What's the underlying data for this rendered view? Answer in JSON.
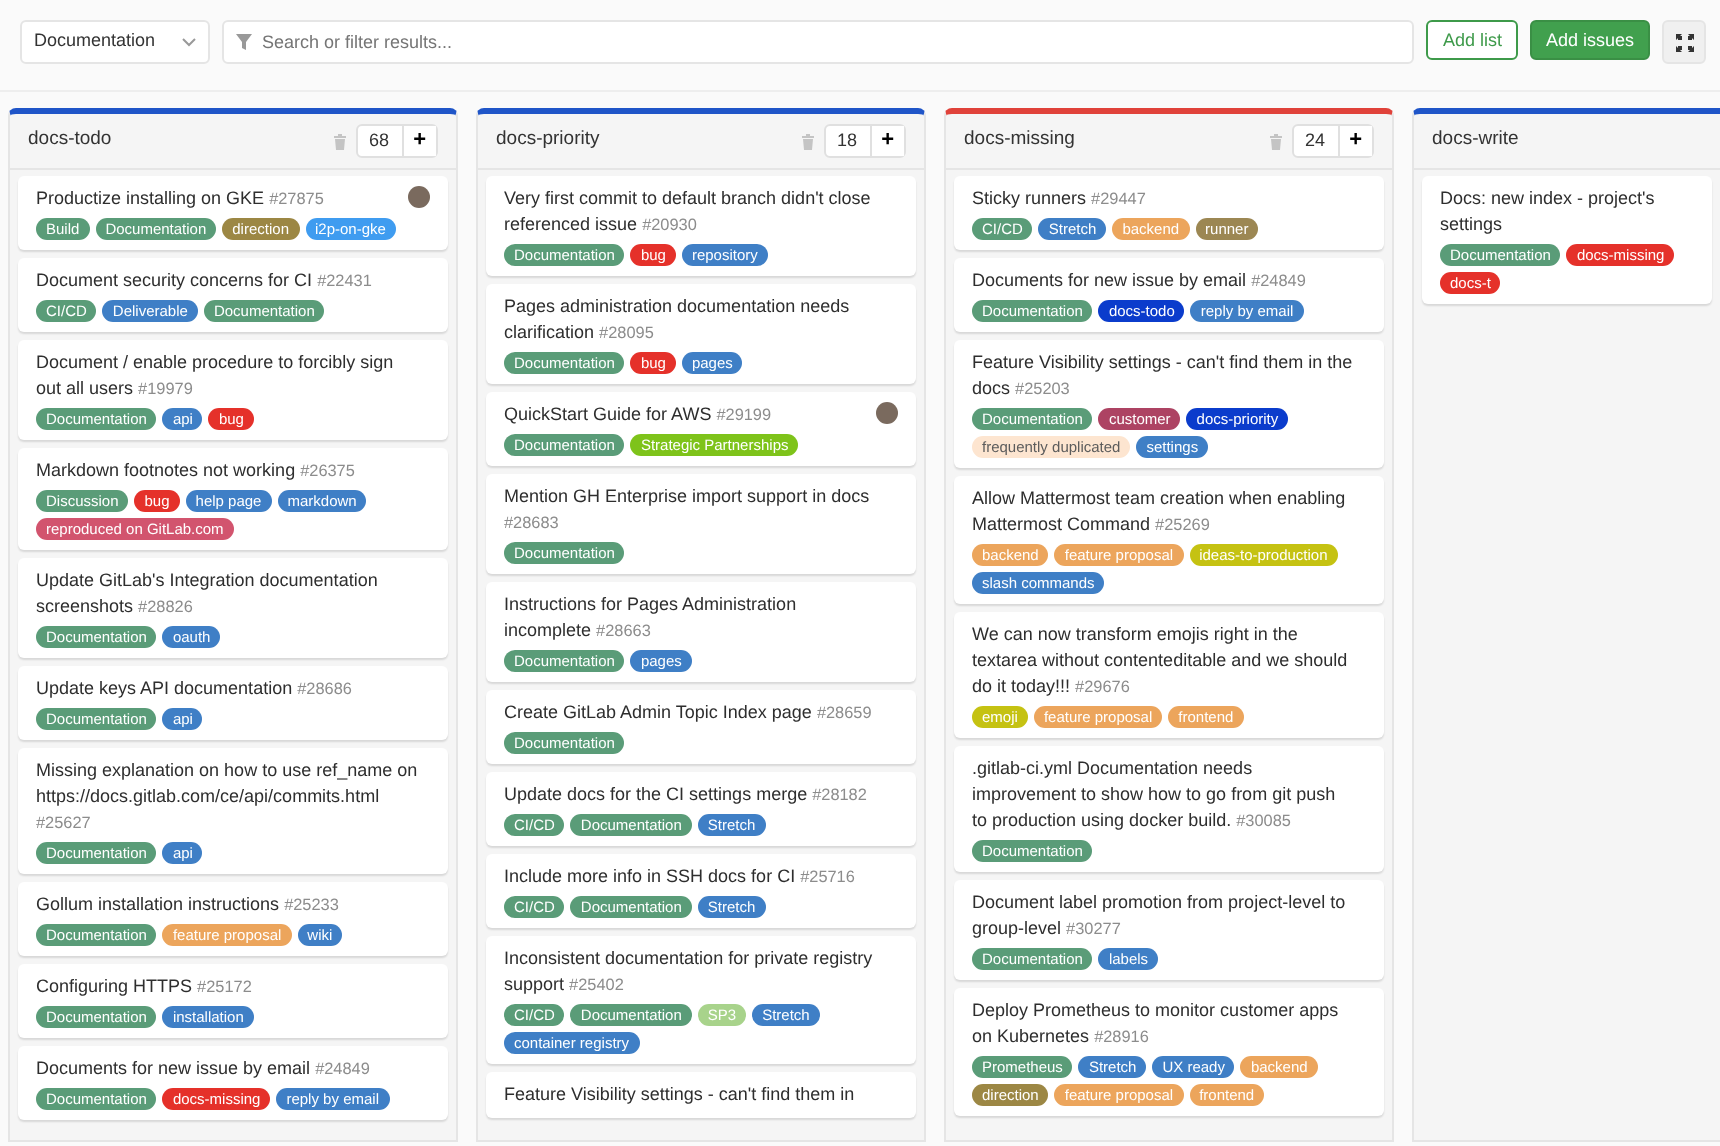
{
  "filter_bar": {
    "board_dropdown": "Documentation",
    "search": {
      "placeholder": "Search or filter results..."
    },
    "buttons": [
      {
        "kind": "outline",
        "label": "Add list"
      },
      {
        "kind": "primary",
        "label": "Add issues"
      },
      {
        "kind": "icon"
      }
    ]
  },
  "lists": [
    {
      "title": "docs-todo",
      "color": "#1f55c8",
      "count": "68",
      "add": "+",
      "cards": [
        {
          "title": "Productize installing on GKE",
          "ref": "#27875",
          "assigned": true,
          "labels": [
            {
              "text": "Build",
              "color": "#5a9c78"
            },
            {
              "text": "Documentation",
              "color": "#5a9c78"
            },
            {
              "text": "direction",
              "color": "#9c8744"
            },
            {
              "text": "i2p-on-gke",
              "color": "#3f9cf0"
            }
          ]
        },
        {
          "title": "Document security concerns for CI",
          "ref": "#22431",
          "assigned": false,
          "labels": [
            {
              "text": "CI/CD",
              "color": "#5a9c78"
            },
            {
              "text": "Deliverable",
              "color": "#3f7fc6"
            },
            {
              "text": "Documentation",
              "color": "#5a9c78"
            }
          ]
        },
        {
          "title": "Document / enable procedure to forcibly sign out all users",
          "ref": "#19979",
          "assigned": false,
          "labels": [
            {
              "text": "Documentation",
              "color": "#5a9c78"
            },
            {
              "text": "api",
              "color": "#3f7fc6"
            },
            {
              "text": "bug",
              "color": "#e5312a"
            }
          ]
        },
        {
          "title": "Markdown footnotes not working",
          "ref": "#26375",
          "assigned": false,
          "labels": [
            {
              "text": "Discussion",
              "color": "#5a9c78"
            },
            {
              "text": "bug",
              "color": "#e5312a"
            },
            {
              "text": "help page",
              "color": "#3f7fc6"
            },
            {
              "text": "markdown",
              "color": "#3f7fc6"
            },
            {
              "text": "reproduced on GitLab.com",
              "color": "#d2546e"
            }
          ]
        },
        {
          "title": "Update GitLab's Integration documentation screenshots",
          "ref": "#28826",
          "assigned": false,
          "labels": [
            {
              "text": "Documentation",
              "color": "#5a9c78"
            },
            {
              "text": "oauth",
              "color": "#3f7fc6"
            }
          ]
        },
        {
          "title": "Update keys API documentation",
          "ref": "#28686",
          "assigned": false,
          "labels": [
            {
              "text": "Documentation",
              "color": "#5a9c78"
            },
            {
              "text": "api",
              "color": "#3f7fc6"
            }
          ]
        },
        {
          "title": "Missing explanation on how to use ref_name on https://docs.gitlab.com/ce/api/commits.html",
          "ref": "#25627",
          "assigned": false,
          "labels": [
            {
              "text": "Documentation",
              "color": "#5a9c78"
            },
            {
              "text": "api",
              "color": "#3f7fc6"
            }
          ]
        },
        {
          "title": "Gollum installation instructions",
          "ref": "#25233",
          "assigned": false,
          "labels": [
            {
              "text": "Documentation",
              "color": "#5a9c78"
            },
            {
              "text": "feature proposal",
              "color": "#eca55c"
            },
            {
              "text": "wiki",
              "color": "#3f7fc6"
            }
          ]
        },
        {
          "title": "Configuring HTTPS",
          "ref": "#25172",
          "assigned": false,
          "labels": [
            {
              "text": "Documentation",
              "color": "#5a9c78"
            },
            {
              "text": "installation",
              "color": "#3f7fc6"
            }
          ]
        },
        {
          "title": "Documents for new issue by email",
          "ref": "#24849",
          "assigned": false,
          "labels": [
            {
              "text": "Documentation",
              "color": "#5a9c78"
            },
            {
              "text": "docs-missing",
              "color": "#e5312a"
            },
            {
              "text": "reply by email",
              "color": "#3f7fc6"
            }
          ]
        }
      ]
    },
    {
      "title": "docs-priority",
      "color": "#1f55c8",
      "count": "18",
      "add": "+",
      "cards": [
        {
          "title": "Very first commit to default branch didn't close referenced issue",
          "ref": "#20930",
          "assigned": false,
          "labels": [
            {
              "text": "Documentation",
              "color": "#5a9c78"
            },
            {
              "text": "bug",
              "color": "#e5312a"
            },
            {
              "text": "repository",
              "color": "#3f7fc6"
            }
          ]
        },
        {
          "title": "Pages administration documentation needs clarification",
          "ref": "#28095",
          "assigned": false,
          "labels": [
            {
              "text": "Documentation",
              "color": "#5a9c78"
            },
            {
              "text": "bug",
              "color": "#e5312a"
            },
            {
              "text": "pages",
              "color": "#3f7fc6"
            }
          ]
        },
        {
          "title": "QuickStart Guide for AWS",
          "ref": "#29199",
          "assigned": true,
          "labels": [
            {
              "text": "Documentation",
              "color": "#5a9c78"
            },
            {
              "text": "Strategic Partnerships",
              "color": "#7ec31a"
            }
          ]
        },
        {
          "title": "Mention GH Enterprise import support in docs",
          "ref": "#28683",
          "assigned": false,
          "labels": [
            {
              "text": "Documentation",
              "color": "#5a9c78"
            }
          ]
        },
        {
          "title": "Instructions for Pages Administration incomplete",
          "ref": "#28663",
          "assigned": false,
          "labels": [
            {
              "text": "Documentation",
              "color": "#5a9c78"
            },
            {
              "text": "pages",
              "color": "#3f7fc6"
            }
          ]
        },
        {
          "title": "Create GitLab Admin Topic Index page",
          "ref": "#28659",
          "assigned": false,
          "labels": [
            {
              "text": "Documentation",
              "color": "#5a9c78"
            }
          ]
        },
        {
          "title": "Update docs for the CI settings merge",
          "ref": "#28182",
          "assigned": false,
          "labels": [
            {
              "text": "CI/CD",
              "color": "#5a9c78"
            },
            {
              "text": "Documentation",
              "color": "#5a9c78"
            },
            {
              "text": "Stretch",
              "color": "#3f7fc6"
            }
          ]
        },
        {
          "title": "Include more info in SSH docs for CI",
          "ref": "#25716",
          "assigned": false,
          "labels": [
            {
              "text": "CI/CD",
              "color": "#5a9c78"
            },
            {
              "text": "Documentation",
              "color": "#5a9c78"
            },
            {
              "text": "Stretch",
              "color": "#3f7fc6"
            }
          ]
        },
        {
          "title": "Inconsistent documentation for private registry support",
          "ref": "#25402",
          "assigned": false,
          "labels": [
            {
              "text": "CI/CD",
              "color": "#5a9c78"
            },
            {
              "text": "Documentation",
              "color": "#5a9c78"
            },
            {
              "text": "SP3",
              "color": "#a8d38b"
            },
            {
              "text": "Stretch",
              "color": "#3f7fc6"
            },
            {
              "text": "container registry",
              "color": "#3f7fc6"
            }
          ]
        },
        {
          "title": "Feature Visibility settings - can't find them in",
          "assigned": false
        }
      ]
    },
    {
      "title": "docs-missing",
      "color": "#e0423a",
      "count": "24",
      "add": "+",
      "cards": [
        {
          "title": "Sticky runners",
          "ref": "#29447",
          "assigned": false,
          "labels": [
            {
              "text": "CI/CD",
              "color": "#5a9c78"
            },
            {
              "text": "Stretch",
              "color": "#3f7fc6"
            },
            {
              "text": "backend",
              "color": "#eca55c"
            },
            {
              "text": "runner",
              "color": "#9c8753"
            }
          ]
        },
        {
          "title": "Documents for new issue by email",
          "ref": "#24849",
          "assigned": false,
          "labels": [
            {
              "text": "Documentation",
              "color": "#5a9c78"
            },
            {
              "text": "docs-todo",
              "color": "#0b3ccc"
            },
            {
              "text": "reply by email",
              "color": "#3f7fc6"
            }
          ]
        },
        {
          "title": "Feature Visibility settings - can't find them in the docs",
          "ref": "#25203",
          "assigned": false,
          "labels": [
            {
              "text": "Documentation",
              "color": "#5a9c78"
            },
            {
              "text": "customer",
              "color": "#ad4363"
            },
            {
              "text": "docs-priority",
              "color": "#0b3ccc"
            },
            {
              "text": "frequently duplicated",
              "color": "#fde5d0"
            },
            {
              "text": "settings",
              "color": "#3f7fc6"
            }
          ]
        },
        {
          "title": "Allow Mattermost team creation when enabling Mattermost Command",
          "ref": "#25269",
          "assigned": false,
          "labels": [
            {
              "text": "backend",
              "color": "#eca55c"
            },
            {
              "text": "feature proposal",
              "color": "#eca55c"
            },
            {
              "text": "ideas-to-production",
              "color": "#c5c212"
            },
            {
              "text": "slash commands",
              "color": "#3f7fc6"
            }
          ]
        },
        {
          "title": "We can now transform emojis right in the textarea without contenteditable and we should do it today!!!",
          "ref": "#29676",
          "assigned": false,
          "labels": [
            {
              "text": "emoji",
              "color": "#c5c212"
            },
            {
              "text": "feature proposal",
              "color": "#eca55c"
            },
            {
              "text": "frontend",
              "color": "#eca55c"
            }
          ]
        },
        {
          "title": ".gitlab-ci.yml Documentation needs improvement to show how to go from git push to production using docker build.",
          "ref": "#30085",
          "assigned": false,
          "labels": [
            {
              "text": "Documentation",
              "color": "#5a9c78"
            }
          ]
        },
        {
          "title": "Document label promotion from project-level to group-level",
          "ref": "#30277",
          "assigned": false,
          "labels": [
            {
              "text": "Documentation",
              "color": "#5a9c78"
            },
            {
              "text": "labels",
              "color": "#3f7fc6"
            }
          ]
        },
        {
          "title": "Deploy Prometheus to monitor customer apps on Kubernetes",
          "ref": "#28916",
          "assigned": false,
          "labels": [
            {
              "text": "Prometheus",
              "color": "#5a9c78"
            },
            {
              "text": "Stretch",
              "color": "#3f7fc6"
            },
            {
              "text": "UX ready",
              "color": "#3f7fc6"
            },
            {
              "text": "backend",
              "color": "#eca55c"
            },
            {
              "text": "direction",
              "color": "#9c8744"
            },
            {
              "text": "feature proposal",
              "color": "#eca55c"
            },
            {
              "text": "frontend",
              "color": "#eca55c"
            }
          ]
        }
      ]
    },
    {
      "title": "docs-write",
      "color": "#1f55c8",
      "cards": [
        {
          "title": "Docs: new index - project's settings",
          "assigned": false,
          "labels": [
            {
              "text": "Documentation",
              "color": "#5a9c78"
            },
            {
              "text": "docs-missing",
              "color": "#e5312a"
            },
            {
              "text": "docs-t",
              "color": "#e5312a"
            }
          ]
        }
      ]
    }
  ]
}
